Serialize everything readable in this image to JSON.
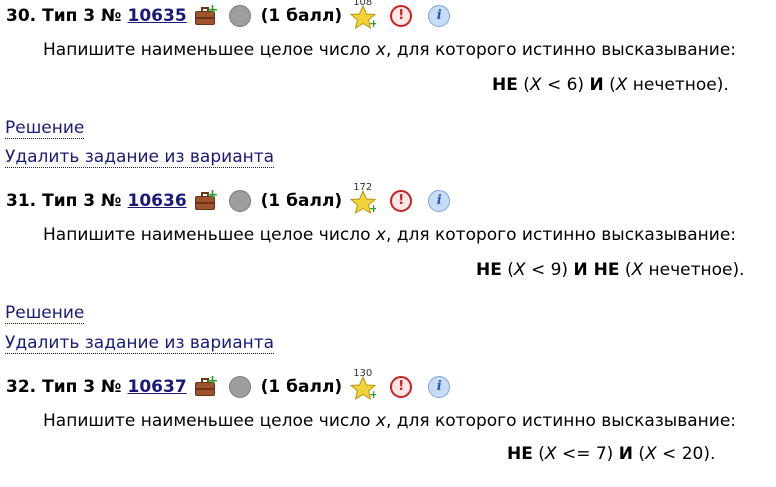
{
  "problems": [
    {
      "number": "30.",
      "type_label": "Тип 3 №",
      "id": "10635",
      "score": "(1 балл)",
      "star_count": "108",
      "alert_glyph": "!",
      "info_glyph": "i",
      "text_before": "Напишите наименьшее целое число ",
      "text_var": "x",
      "text_after": ", для которого истинно высказывание:",
      "formula": [
        {
          "t": "b",
          "v": "НЕ"
        },
        {
          "t": "n",
          "v": " ("
        },
        {
          "t": "i",
          "v": "X"
        },
        {
          "t": "n",
          "v": " < 6) "
        },
        {
          "t": "b",
          "v": "И"
        },
        {
          "t": "n",
          "v": " ("
        },
        {
          "t": "i",
          "v": "X"
        },
        {
          "t": "n",
          "v": " нечетное)."
        }
      ],
      "solution_link": "Решение",
      "remove_link": "Удалить задание из варианта"
    },
    {
      "number": "31.",
      "type_label": "Тип 3 №",
      "id": "10636",
      "score": "(1 балл)",
      "star_count": "172",
      "alert_glyph": "!",
      "info_glyph": "i",
      "text_before": "Напишите наименьшее целое число ",
      "text_var": "x",
      "text_after": ", для которого истинно высказывание:",
      "formula": [
        {
          "t": "b",
          "v": "НЕ"
        },
        {
          "t": "n",
          "v": " ("
        },
        {
          "t": "i",
          "v": "X"
        },
        {
          "t": "n",
          "v": " < 9) "
        },
        {
          "t": "b",
          "v": "И НЕ"
        },
        {
          "t": "n",
          "v": " ("
        },
        {
          "t": "i",
          "v": "X"
        },
        {
          "t": "n",
          "v": " нечетное)."
        }
      ],
      "solution_link": "Решение",
      "remove_link": "Удалить задание из варианта"
    },
    {
      "number": "32.",
      "type_label": "Тип 3 №",
      "id": "10637",
      "score": "(1 балл)",
      "star_count": "130",
      "alert_glyph": "!",
      "info_glyph": "i",
      "text_before": "Напишите наименьшее целое число ",
      "text_var": "x",
      "text_after": ", для которого истинно высказывание:",
      "formula": [
        {
          "t": "b",
          "v": "НЕ"
        },
        {
          "t": "n",
          "v": " ("
        },
        {
          "t": "i",
          "v": "X"
        },
        {
          "t": "n",
          "v": " <= 7) "
        },
        {
          "t": "b",
          "v": "И"
        },
        {
          "t": "n",
          "v": " ("
        },
        {
          "t": "i",
          "v": "X"
        },
        {
          "t": "n",
          "v": " < 20)."
        }
      ]
    }
  ],
  "colors": {
    "link": "#1a1a7a",
    "alert": "#cc1f1f",
    "info": "#2a54b5",
    "circle": "#9e9e9e",
    "star": "#f2d43a",
    "plus": "#2e9b2e"
  },
  "icons": {
    "add": "briefcase-plus-icon",
    "status": "status-circle-icon",
    "star": "star-icon",
    "alert": "alert-icon",
    "info": "info-icon"
  }
}
